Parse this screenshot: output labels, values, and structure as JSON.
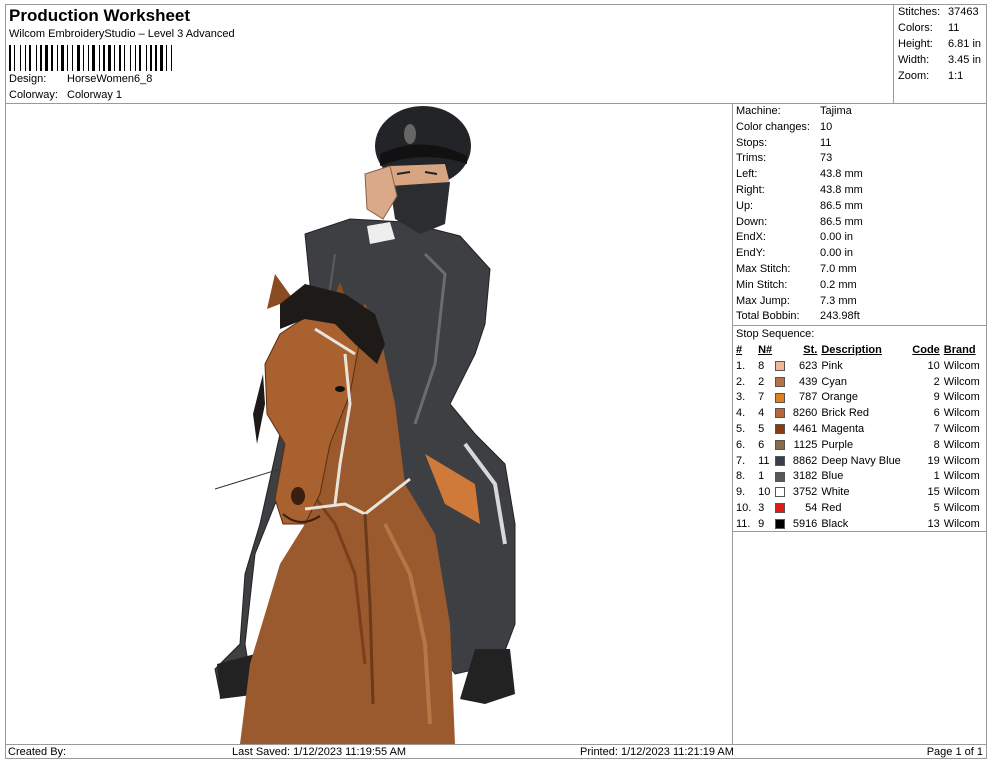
{
  "header": {
    "title": "Production Worksheet",
    "subtitle": "Wilcom EmbroideryStudio – Level 3 Advanced",
    "design_label": "Design:",
    "design_value": "HorseWomen6_8",
    "colorway_label": "Colorway:",
    "colorway_value": "Colorway 1"
  },
  "stats": [
    {
      "label": "Stitches:",
      "value": "37463"
    },
    {
      "label": "Colors:",
      "value": "11"
    },
    {
      "label": "Height:",
      "value": "6.81 in"
    },
    {
      "label": "Width:",
      "value": "3.45 in"
    },
    {
      "label": "Zoom:",
      "value": "1:1"
    }
  ],
  "machine_info": [
    {
      "label": "Machine:",
      "value": "Tajima"
    },
    {
      "label": "Color changes:",
      "value": "10"
    },
    {
      "label": "Stops:",
      "value": "11"
    },
    {
      "label": "Trims:",
      "value": "73"
    },
    {
      "label": "Left:",
      "value": "43.8 mm"
    },
    {
      "label": "Right:",
      "value": "43.8 mm"
    },
    {
      "label": "Up:",
      "value": "86.5 mm"
    },
    {
      "label": "Down:",
      "value": "86.5 mm"
    },
    {
      "label": "EndX:",
      "value": "0.00 in"
    },
    {
      "label": "EndY:",
      "value": "0.00 in"
    },
    {
      "label": "Max Stitch:",
      "value": "7.0 mm"
    },
    {
      "label": "Min Stitch:",
      "value": "0.2 mm"
    },
    {
      "label": "Max Jump:",
      "value": "7.3 mm"
    },
    {
      "label": "Total Bobbin:",
      "value": "243.98ft"
    }
  ],
  "stop_sequence": {
    "title": "Stop Sequence:",
    "headers": {
      "index": "#",
      "number": "N#",
      "stitches": "St.",
      "description": "Description",
      "code": "Code",
      "brand": "Brand"
    },
    "rows": [
      {
        "index": "1.",
        "number": "8",
        "color": "#f2b595",
        "stitches": "623",
        "description": "Pink",
        "code": "10",
        "brand": "Wilcom"
      },
      {
        "index": "2.",
        "number": "2",
        "color": "#b5714a",
        "stitches": "439",
        "description": "Cyan",
        "code": "2",
        "brand": "Wilcom"
      },
      {
        "index": "3.",
        "number": "7",
        "color": "#e0801d",
        "stitches": "787",
        "description": "Orange",
        "code": "9",
        "brand": "Wilcom"
      },
      {
        "index": "4.",
        "number": "4",
        "color": "#b7673a",
        "stitches": "8260",
        "description": "Brick Red",
        "code": "6",
        "brand": "Wilcom"
      },
      {
        "index": "5.",
        "number": "5",
        "color": "#8a3a10",
        "stitches": "4461",
        "description": "Magenta",
        "code": "7",
        "brand": "Wilcom"
      },
      {
        "index": "6.",
        "number": "6",
        "color": "#8a6a48",
        "stitches": "1125",
        "description": "Purple",
        "code": "8",
        "brand": "Wilcom"
      },
      {
        "index": "7.",
        "number": "11",
        "color": "#3a3e4a",
        "stitches": "8862",
        "description": "Deep Navy Blue",
        "code": "19",
        "brand": "Wilcom"
      },
      {
        "index": "8.",
        "number": "1",
        "color": "#585858",
        "stitches": "3182",
        "description": "Blue",
        "code": "1",
        "brand": "Wilcom"
      },
      {
        "index": "9.",
        "number": "10",
        "color": "#ffffff",
        "stitches": "3752",
        "description": "White",
        "code": "15",
        "brand": "Wilcom"
      },
      {
        "index": "10.",
        "number": "3",
        "color": "#e01a1a",
        "stitches": "54",
        "description": "Red",
        "code": "5",
        "brand": "Wilcom"
      },
      {
        "index": "11.",
        "number": "9",
        "color": "#000000",
        "stitches": "5916",
        "description": "Black",
        "code": "13",
        "brand": "Wilcom"
      }
    ]
  },
  "footer": {
    "created_by": "Created By:",
    "last_saved": "Last Saved: 1/12/2023 11:19:55 AM",
    "printed": "Printed: 1/12/2023 11:21:19 AM",
    "page": "Page 1 of 1"
  }
}
